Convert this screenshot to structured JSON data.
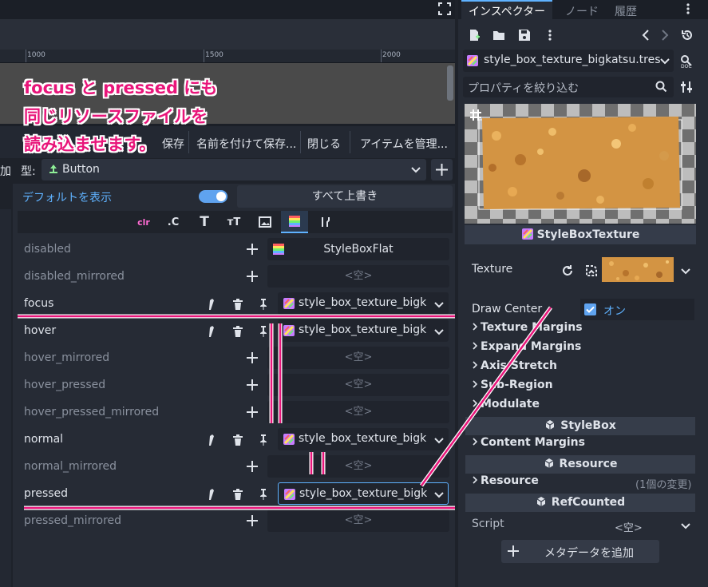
{
  "annotation": {
    "line1": "focus と pressed にも",
    "line2": "同じリソースファイルを",
    "line3": "読み込ませます。"
  },
  "ruler": {
    "ticks": [
      "1000",
      "1500",
      "2000"
    ]
  },
  "toolbar": {
    "save": "保存",
    "save_as": "名前を付けて保存...",
    "close": "閉じる",
    "manage_items": "アイテムを管理...",
    "add_partial": "加"
  },
  "type_row": {
    "label": "型:",
    "value": "Button"
  },
  "defaults_link": "デフォルトを表示",
  "override_all": "すべて上書き",
  "type_tabs": [
    {
      "icon": "color-icon",
      "text": "clr"
    },
    {
      "icon": "constant-icon",
      "text": ".C"
    },
    {
      "icon": "font-icon",
      "text": "T"
    },
    {
      "icon": "font-size-icon",
      "text": "тT"
    },
    {
      "icon": "image-icon",
      "text": ""
    },
    {
      "icon": "stylebox-icon",
      "text": "",
      "active": true
    },
    {
      "icon": "tools-icon",
      "text": ""
    }
  ],
  "empty_label": "<空>",
  "properties": [
    {
      "name": "disabled",
      "overridden": false,
      "value": "StyleBoxFlat"
    },
    {
      "name": "disabled_mirrored",
      "overridden": false,
      "value": ""
    },
    {
      "name": "focus",
      "overridden": true,
      "value": "style_box_texture_bigka"
    },
    {
      "name": "hover",
      "overridden": true,
      "value": "style_box_texture_bigka"
    },
    {
      "name": "hover_mirrored",
      "overridden": false,
      "value": ""
    },
    {
      "name": "hover_pressed",
      "overridden": false,
      "value": ""
    },
    {
      "name": "hover_pressed_mirrored",
      "overridden": false,
      "value": ""
    },
    {
      "name": "normal",
      "overridden": true,
      "value": "style_box_texture_bigka"
    },
    {
      "name": "normal_mirrored",
      "overridden": false,
      "value": ""
    },
    {
      "name": "pressed",
      "overridden": true,
      "value": "style_box_texture_bigka"
    },
    {
      "name": "pressed_mirrored",
      "overridden": false,
      "value": ""
    }
  ],
  "inspector": {
    "tabs": [
      "インスペクター",
      "ノード",
      "履歴"
    ],
    "resource_name": "style_box_texture_bigkatsu.tres",
    "filter_placeholder": "プロパティを絞り込む",
    "resource_type": "StyleBoxTexture",
    "texture_label": "Texture",
    "draw_center_label": "Draw Center",
    "draw_center_value": "オン",
    "groups": [
      "Texture Margins",
      "Expand Margins",
      "Axis Stretch",
      "Sub-Region",
      "Modulate"
    ],
    "stylebox_section": "StyleBox",
    "content_margins": "Content Margins",
    "resource_section": "Resource",
    "resource_group": "Resource",
    "resource_changes": "(1個の変更)",
    "refcounted_section": "RefCounted",
    "script_label": "Script",
    "script_value": "<空>",
    "add_metadata": "メタデータを追加"
  },
  "colors": {
    "accent": "#5fb2ff",
    "annotation": "#e8157a",
    "panel": "#262b35"
  }
}
